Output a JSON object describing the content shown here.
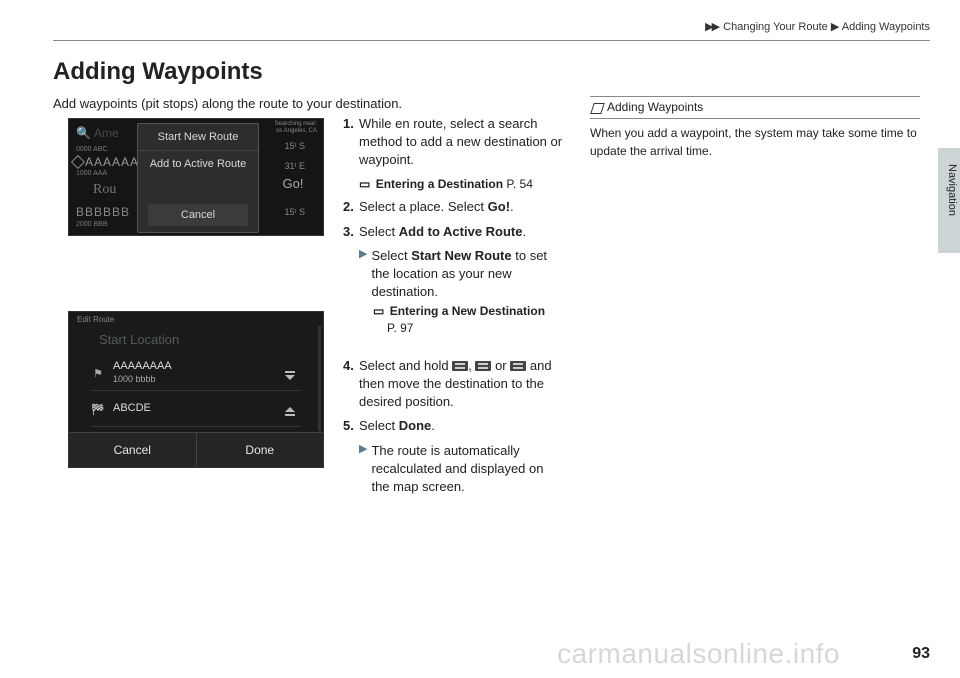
{
  "breadcrumb": {
    "a": "Changing Your Route",
    "b": "Adding Waypoints"
  },
  "title": "Adding Waypoints",
  "intro": "Add waypoints (pit stops) along the route to your destination.",
  "side_tab": "Navigation",
  "page_number": "93",
  "watermark": "carmanualsonline.info",
  "shot1": {
    "search_prefix": "Ame",
    "sub1": "0000 ABC",
    "row_a": "AAAAAA",
    "sub2": "1000 AAA",
    "row_r": "Rou",
    "row_b": "BBBBBB",
    "sub3": "2000 BBB",
    "go": "Go!",
    "d1": "15ᵗ  S",
    "d2": "31ᵗ  E",
    "d3": "15ᵗ  S",
    "near1": "Searching near:",
    "near2": "os Angeles, CA",
    "popup1": "Start New Route",
    "popup2": "Add to Active Route",
    "popup_cancel": "Cancel"
  },
  "shot2": {
    "hdr": "Edit Route",
    "startloc": "Start Location",
    "r1a": "AAAAAAAA",
    "r1b": "1000 bbbb",
    "r2": "ABCDE",
    "cancel": "Cancel",
    "done": "Done"
  },
  "steps": {
    "s1_num": "1.",
    "s1": "While en route, select a search method to add a new destination or waypoint.",
    "s1_ref_label": "Entering a Destination",
    "s1_ref_page": "P. 54",
    "s2_num": "2.",
    "s2a": "Select a place. Select ",
    "s2b": "Go!",
    "s2c": ".",
    "s3_num": "3.",
    "s3a": "Select ",
    "s3b": "Add to Active Route",
    "s3c": ".",
    "s3_sub_a": "Select ",
    "s3_sub_b": "Start New Route",
    "s3_sub_c": " to set the location as your new destination.",
    "s3_ref_label": "Entering a New Destination",
    "s3_ref_page": "P. 97",
    "s4_num": "4.",
    "s4a": "Select and hold ",
    "s4b": ", ",
    "s4c": " or ",
    "s4d": " and then move the destination to the desired position.",
    "s5_num": "5.",
    "s5a": "Select ",
    "s5b": "Done",
    "s5c": ".",
    "s5_sub": "The route is automatically recalculated and displayed on the map screen."
  },
  "info": {
    "hdr": "Adding Waypoints",
    "body": "When you add a waypoint, the system may take some time to update the arrival time."
  }
}
